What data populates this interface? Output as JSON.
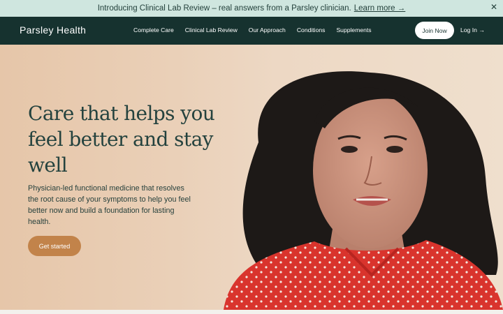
{
  "announcement": {
    "text": "Introducing Clinical Lab Review – real answers from a Parsley clinician.",
    "link": "Learn more →",
    "close_icon": "close-icon"
  },
  "nav": {
    "logo": "Parsley Health",
    "items": [
      {
        "label": "Complete Care"
      },
      {
        "label": "Clinical Lab Review"
      },
      {
        "label": "Our Approach"
      },
      {
        "label": "Conditions"
      },
      {
        "label": "Supplements"
      }
    ],
    "join": "Join Now",
    "login": "Log In →"
  },
  "hero": {
    "headline": "Care that helps you feel better and stay well",
    "subheading": "Physician-led functional medicine that resolves the root cause of your symptoms to help you feel better now and build a foundation for lasting health.",
    "cta": "Get started"
  },
  "colors": {
    "announcement_bg": "#cfe6df",
    "nav_bg": "#16322f",
    "cta": "#c2834a",
    "headline": "#24423e"
  }
}
